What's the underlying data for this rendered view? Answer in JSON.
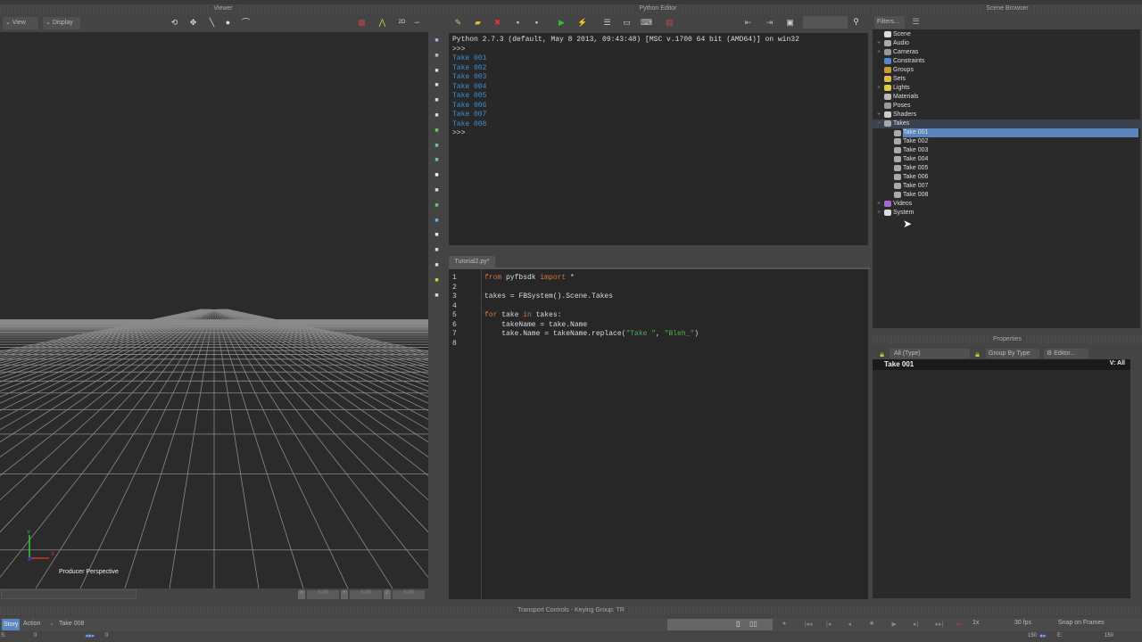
{
  "viewer": {
    "title": "Viewer",
    "view_btn": "View",
    "display_btn": "Display",
    "camera_label": "Producer Perspective",
    "axis_x": "X",
    "axis_y": "Y",
    "coord_labels": [
      "X",
      "Y",
      "Z"
    ],
    "coord_values": [
      "0.00",
      "0.00",
      "0.00"
    ]
  },
  "python_editor": {
    "title": "Python Editor",
    "console": {
      "header": "Python 2.7.3 (default, May  8 2013, 09:43:48) [MSC v.1700 64 bit (AMD64)] on win32",
      "prompt": ">>>",
      "output": [
        "Take 001",
        "Take 002",
        "Take 003",
        "Take 004",
        "Take 005",
        "Take 006",
        "Take 007",
        "Take 008"
      ]
    },
    "tab": "Tutorial2.py*",
    "code": [
      {
        "n": "1",
        "parts": [
          {
            "t": "from",
            "c": "kw"
          },
          {
            "t": " pyfbsdk ",
            "c": "tx"
          },
          {
            "t": "import",
            "c": "kw"
          },
          {
            "t": " *",
            "c": "tx"
          }
        ]
      },
      {
        "n": "2",
        "parts": []
      },
      {
        "n": "3",
        "parts": [
          {
            "t": "takes = FBSystem().Scene.Takes",
            "c": "tx"
          }
        ]
      },
      {
        "n": "4",
        "parts": []
      },
      {
        "n": "5",
        "parts": [
          {
            "t": "for",
            "c": "kw"
          },
          {
            "t": " take ",
            "c": "tx"
          },
          {
            "t": "in",
            "c": "kw"
          },
          {
            "t": " takes:",
            "c": "tx"
          }
        ]
      },
      {
        "n": "6",
        "parts": [
          {
            "t": "    takeName = take.Name",
            "c": "tx"
          }
        ]
      },
      {
        "n": "7",
        "parts": [
          {
            "t": "    take.Name = takeName.replace(",
            "c": "tx"
          },
          {
            "t": "\"Take \"",
            "c": "st"
          },
          {
            "t": ", ",
            "c": "tx"
          },
          {
            "t": "\"Bleh_\"",
            "c": "st"
          },
          {
            "t": ")",
            "c": "tx"
          }
        ]
      },
      {
        "n": "8",
        "parts": []
      }
    ]
  },
  "scene_browser": {
    "title": "Scene Browser",
    "filters_btn": "Filters...",
    "items": [
      {
        "label": "Scene",
        "depth": 0,
        "exp": "",
        "color": "#ddd"
      },
      {
        "label": "Audio",
        "depth": 0,
        "exp": "+",
        "color": "#aaa"
      },
      {
        "label": "Cameras",
        "depth": 0,
        "exp": "+",
        "color": "#999"
      },
      {
        "label": "Constraints",
        "depth": 0,
        "exp": "",
        "color": "#58c"
      },
      {
        "label": "Groups",
        "depth": 0,
        "exp": "",
        "color": "#c93"
      },
      {
        "label": "Sets",
        "depth": 0,
        "exp": "",
        "color": "#db4"
      },
      {
        "label": "Lights",
        "depth": 0,
        "exp": "+",
        "color": "#dc4"
      },
      {
        "label": "Materials",
        "depth": 0,
        "exp": "",
        "color": "#bbb"
      },
      {
        "label": "Poses",
        "depth": 0,
        "exp": "",
        "color": "#999"
      },
      {
        "label": "Shaders",
        "depth": 0,
        "exp": "+",
        "color": "#ccc"
      },
      {
        "label": "Takes",
        "depth": 0,
        "exp": "−",
        "color": "#aaa"
      },
      {
        "label": "Take 001",
        "depth": 1,
        "exp": "",
        "color": "#aaa",
        "selected": true
      },
      {
        "label": "Take 002",
        "depth": 1,
        "exp": "",
        "color": "#aaa"
      },
      {
        "label": "Take 003",
        "depth": 1,
        "exp": "",
        "color": "#aaa"
      },
      {
        "label": "Take 004",
        "depth": 1,
        "exp": "",
        "color": "#aaa"
      },
      {
        "label": "Take 005",
        "depth": 1,
        "exp": "",
        "color": "#aaa"
      },
      {
        "label": "Take 006",
        "depth": 1,
        "exp": "",
        "color": "#aaa"
      },
      {
        "label": "Take 007",
        "depth": 1,
        "exp": "",
        "color": "#aaa"
      },
      {
        "label": "Take 008",
        "depth": 1,
        "exp": "",
        "color": "#aaa"
      },
      {
        "label": "Videos",
        "depth": 0,
        "exp": "+",
        "color": "#a6c"
      },
      {
        "label": "System",
        "depth": 0,
        "exp": "+",
        "color": "#ddd"
      }
    ]
  },
  "properties": {
    "title": "Properties",
    "filter": "All (Type)",
    "group_by": "Group By Type",
    "editor_btn": "Editor...",
    "selected_name": "Take 001",
    "view_label": "V: All"
  },
  "transport": {
    "title": "Transport Controls  -  Keying Group: TR",
    "story_tab": "Story",
    "action_tab": "Action",
    "take_name": "Take 008",
    "speed": "1x",
    "fps": "30 fps",
    "snap": "Snap on Frames",
    "start_label": "S:",
    "start_value": "0",
    "current_frame": "0",
    "end_frame_marker": "150",
    "end_label": "E:",
    "end_value": "150"
  },
  "colors": {
    "selection": "#5b86bd",
    "keyword": "#d5773b",
    "string": "#4caf50",
    "console_output": "#3d8ed6"
  }
}
